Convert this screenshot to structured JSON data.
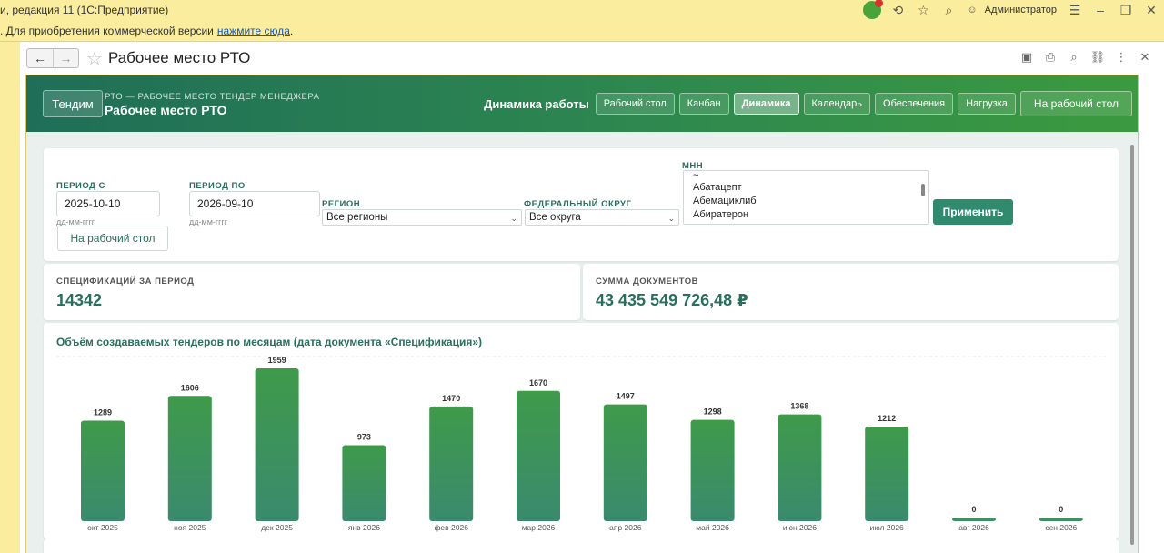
{
  "window": {
    "title": "и, редакция 11  (1С:Предприятие)",
    "user": "Администратор"
  },
  "notice": {
    "text": ". Для приобретения коммерческой версии",
    "link": "нажмите сюда",
    "suffix": "."
  },
  "form": {
    "title": "Рабочее место РТО"
  },
  "header": {
    "brand_button": "Тендим",
    "subtitle": "РТО — РАБОЧЕЕ МЕСТО ТЕНДЕР МЕНЕДЖЕРА",
    "title": "Рабочее место РТО",
    "section_label": "Динамика работы",
    "tabs": [
      {
        "label": "Рабочий стол",
        "active": false
      },
      {
        "label": "Канбан",
        "active": false
      },
      {
        "label": "Динамика",
        "active": true
      },
      {
        "label": "Календарь",
        "active": false
      },
      {
        "label": "Обеспечения",
        "active": false
      },
      {
        "label": "Нагрузка",
        "active": false
      }
    ],
    "desktop_button": "На рабочий стол"
  },
  "filters": {
    "period_from_label": "ПЕРИОД С",
    "period_from_value": "2025-10-10",
    "period_from_hint": "дд-мм-гггг",
    "period_to_label": "ПЕРИОД ПО",
    "period_to_value": "2026-09-10",
    "period_to_hint": "дд-мм-гггг",
    "desktop_button": "На рабочий стол",
    "region_label": "РЕГИОН",
    "region_value": "Все регионы",
    "district_label": "ФЕДЕРАЛЬНЫЙ ОКРУГ",
    "district_value": "Все округа",
    "mnn_label": "МНН",
    "mnn_items": [
      "~",
      "Абатацепт",
      "Абемациклиб",
      "Абиратерон"
    ],
    "apply_button": "Применить"
  },
  "stats": {
    "specs_label": "СПЕЦИФИКАЦИЙ ЗА ПЕРИОД",
    "specs_value": "14342",
    "sum_label": "СУММА ДОКУМЕНТОВ",
    "sum_value": "43 435 549 726,48 ₽"
  },
  "colors": {
    "accent": "#2f8a6e",
    "bar_top": "#3f9a4a",
    "bar_bottom": "#3a8a6e"
  },
  "chart_data": {
    "type": "bar",
    "title": "Объём создаваемых тендеров по месяцам (дата документа «Спецификация»)",
    "categories": [
      "окт 2025",
      "ноя 2025",
      "дек 2025",
      "янв 2026",
      "фев 2026",
      "мар 2026",
      "апр 2026",
      "май 2026",
      "июн 2026",
      "июл 2026",
      "авг 2026",
      "сен 2026"
    ],
    "values": [
      1289,
      1606,
      1959,
      973,
      1470,
      1670,
      1497,
      1298,
      1368,
      1212,
      0,
      0
    ],
    "ylim": [
      0,
      1959
    ],
    "grid": false
  }
}
